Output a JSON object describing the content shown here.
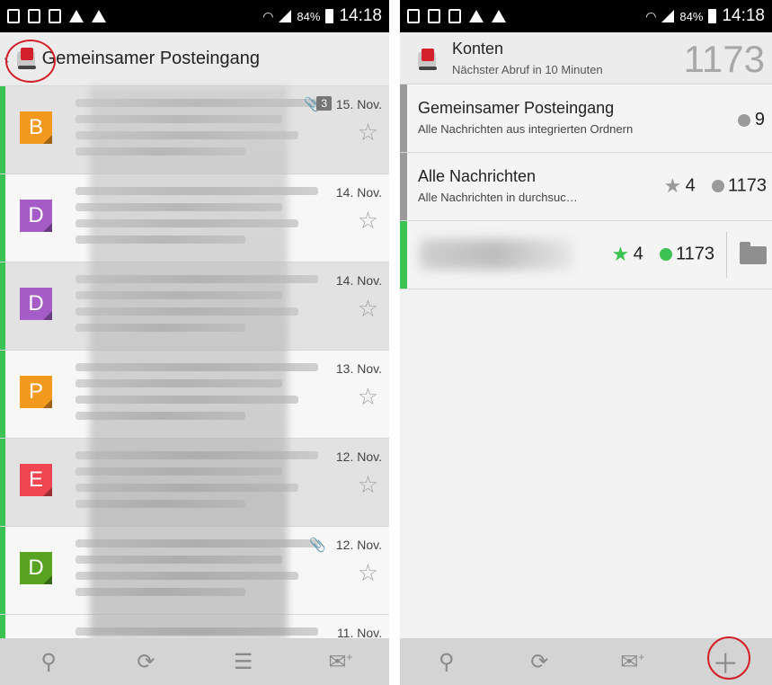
{
  "left": {
    "statusbar": {
      "battery": "84%",
      "time": "14:18"
    },
    "header": {
      "title": "Gemeinsamer Posteingang",
      "back": "‹"
    },
    "messages": [
      {
        "initial": "B",
        "color": "#f39a1e",
        "date": "15. Nov.",
        "attachment": true,
        "count": "3",
        "read": true
      },
      {
        "initial": "D",
        "color": "#a55cc7",
        "date": "14. Nov.",
        "attachment": false,
        "count": "",
        "read": false
      },
      {
        "initial": "D",
        "color": "#a55cc7",
        "date": "14. Nov.",
        "attachment": false,
        "count": "",
        "read": true
      },
      {
        "initial": "P",
        "color": "#f39a1e",
        "date": "13. Nov.",
        "attachment": false,
        "count": "",
        "read": false
      },
      {
        "initial": "E",
        "color": "#ef4652",
        "date": "12. Nov.",
        "attachment": false,
        "count": "",
        "read": true
      },
      {
        "initial": "D",
        "color": "#58a422",
        "date": "12. Nov.",
        "attachment": true,
        "count": "",
        "read": false
      },
      {
        "initial": "",
        "color": "#ffffff",
        "date": "11. Nov.",
        "attachment": false,
        "count": "",
        "read": false
      }
    ],
    "bottom_icons": [
      "search-icon",
      "refresh-icon",
      "sort-icon",
      "compose-icon"
    ]
  },
  "right": {
    "statusbar": {
      "battery": "84%",
      "time": "14:18"
    },
    "header": {
      "title": "Konten",
      "subtitle": "Nächster Abruf in 10 Minuten",
      "total": "1173"
    },
    "accounts": [
      {
        "title": "Gemeinsamer Posteingang",
        "subtitle": "Alle Nachrichten aus integrierten Ordnern",
        "starred": "",
        "unread": "9"
      },
      {
        "title": "Alle Nachrichten",
        "subtitle": "Alle Nachrichten in durchsuc…",
        "starred": "4",
        "unread": "1173"
      },
      {
        "title": "",
        "subtitle": "",
        "starred": "4",
        "unread": "1173"
      }
    ],
    "bottom_icons": [
      "search-icon",
      "refresh-icon",
      "compose-icon",
      "add-account-icon"
    ]
  }
}
